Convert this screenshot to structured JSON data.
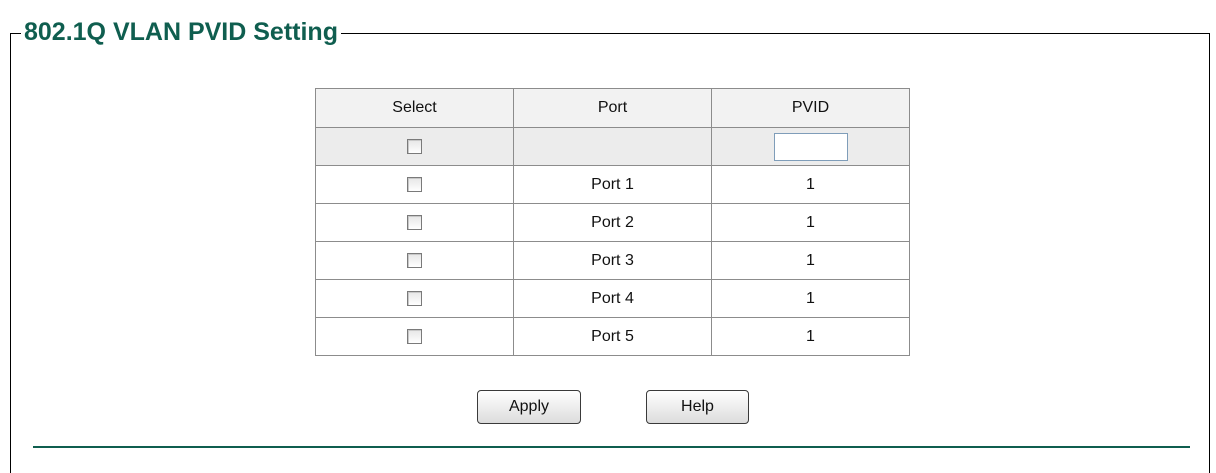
{
  "section": {
    "title": "802.1Q VLAN PVID Setting"
  },
  "table": {
    "headers": {
      "select": "Select",
      "port": "Port",
      "pvid": "PVID"
    },
    "bulk_row": {
      "pvid_value": "",
      "checked": false
    },
    "rows": [
      {
        "port": "Port 1",
        "pvid": "1",
        "checked": false
      },
      {
        "port": "Port 2",
        "pvid": "1",
        "checked": false
      },
      {
        "port": "Port 3",
        "pvid": "1",
        "checked": false
      },
      {
        "port": "Port 4",
        "pvid": "1",
        "checked": false
      },
      {
        "port": "Port 5",
        "pvid": "1",
        "checked": false
      }
    ]
  },
  "buttons": {
    "apply": "Apply",
    "help": "Help"
  },
  "colors": {
    "title": "#0f5e4f",
    "rule": "#0f5e4f",
    "header_bg": "#f2f2f2",
    "bulk_row_bg": "#ececec",
    "border": "#8c8c8c"
  }
}
